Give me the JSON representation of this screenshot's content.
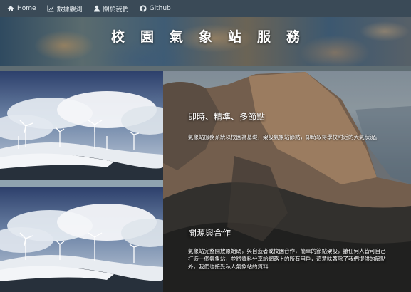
{
  "nav": {
    "items": [
      {
        "label": "Home",
        "icon": "home-icon"
      },
      {
        "label": "數據觀測",
        "icon": "chart-icon"
      },
      {
        "label": "關於我們",
        "icon": "users-icon"
      },
      {
        "label": "Github",
        "icon": "github-icon"
      }
    ]
  },
  "banner": {
    "title": "校園氣象站服務"
  },
  "sections": [
    {
      "title": "即時、精準、多節點",
      "text": "氣象站服務系統以校園為基礎，架設氣象站節點，即時取得學校附近的天氣狀況。"
    },
    {
      "title": "開源與合作",
      "text": "氣象站完整開放原始碼，與自造者或校園合作，簡單的節點架設，讓任何人皆可自己打造一個氣象站，並將資料分享給網路上的所有用戶，這意味著除了我們提供的節點外，我們也接受私人氣象站的資料"
    }
  ],
  "colors": {
    "navbar": "#3a4a57",
    "text": "#ffffff",
    "separator": "#8fa3b0"
  }
}
